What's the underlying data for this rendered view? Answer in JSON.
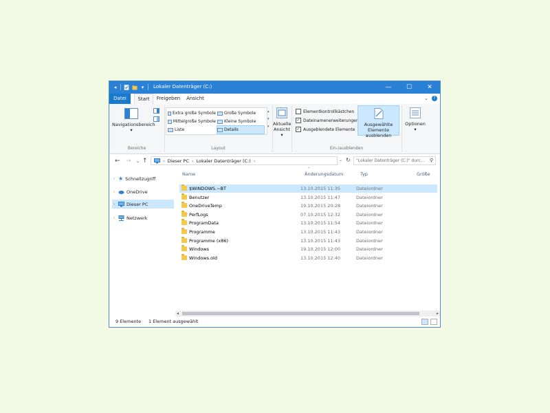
{
  "window": {
    "title": "Lokaler Datenträger (C:)",
    "accent": "#2b81d6",
    "controls": {
      "minimize": "—",
      "maximize": "☐",
      "close": "✕"
    }
  },
  "quick_access_toolbar": {
    "icons": [
      "back-icon",
      "properties-icon",
      "new-folder-icon",
      "dropdown-icon"
    ]
  },
  "ribbon": {
    "tabs": [
      {
        "label": "Datei"
      },
      {
        "label": "Start"
      },
      {
        "label": "Freigeben"
      },
      {
        "label": "Ansicht"
      }
    ],
    "active_tab": "Ansicht",
    "groups": {
      "bereiche": {
        "label": "Bereiche",
        "navigationsbereich": "Navigationsbereich"
      },
      "layout": {
        "label": "Layout",
        "items": [
          {
            "label": "Extra große Symbole"
          },
          {
            "label": "Große Symbole"
          },
          {
            "label": "Mittelgroße Symbole"
          },
          {
            "label": "Kleine Symbole"
          },
          {
            "label": "Liste"
          },
          {
            "label": "Details"
          }
        ],
        "selected": "Details"
      },
      "aktuelle_ansicht": {
        "label": "Aktuelle Ansicht"
      },
      "ein_ausblenden": {
        "label": "Ein-/ausblenden",
        "checkboxes": [
          {
            "label": "Elementkontrollkästchen",
            "checked": false
          },
          {
            "label": "Dateinamenerweiterungen",
            "checked": true
          },
          {
            "label": "Ausgeblendete Elemente",
            "checked": true
          }
        ],
        "hide_selected": "Ausgewählte Elemente ausblenden"
      },
      "optionen": {
        "label": "Optionen"
      }
    }
  },
  "address_bar": {
    "path": [
      "Dieser PC",
      "Lokaler Datenträger (C:)"
    ],
    "search_placeholder": "\"Lokaler Datenträger (C:)\" durc..."
  },
  "nav_pane": {
    "items": [
      {
        "label": "Schnellzugriff",
        "icon": "star-icon"
      },
      {
        "label": "OneDrive",
        "icon": "cloud-icon"
      },
      {
        "label": "Dieser PC",
        "icon": "computer-icon",
        "selected": true
      },
      {
        "label": "Netzwerk",
        "icon": "network-icon"
      }
    ]
  },
  "file_list": {
    "columns": [
      "Name",
      "Änderungsdatum",
      "Typ",
      "Größe"
    ],
    "rows": [
      {
        "name": "$WINDOWS.~BT",
        "date": "13.10.2015 11:35",
        "type": "Dateiordner",
        "selected": true
      },
      {
        "name": "Benutzer",
        "date": "13.10.2015 11:47",
        "type": "Dateiordner"
      },
      {
        "name": "OneDriveTemp",
        "date": "19.10.2015 20:28",
        "type": "Dateiordner"
      },
      {
        "name": "PerfLogs",
        "date": "07.10.2015 12:32",
        "type": "Dateiordner"
      },
      {
        "name": "ProgramData",
        "date": "13.10.2015 11:54",
        "type": "Dateiordner"
      },
      {
        "name": "Programme",
        "date": "13.10.2015 11:43",
        "type": "Dateiordner"
      },
      {
        "name": "Programme (x86)",
        "date": "13.10.2015 11:43",
        "type": "Dateiordner"
      },
      {
        "name": "Windows",
        "date": "19.10.2015 12:00",
        "type": "Dateiordner"
      },
      {
        "name": "Windows.old",
        "date": "13.10.2015 12:40",
        "type": "Dateiordner"
      }
    ]
  },
  "status_bar": {
    "count": "9 Elemente",
    "selection": "1 Element ausgewählt"
  }
}
